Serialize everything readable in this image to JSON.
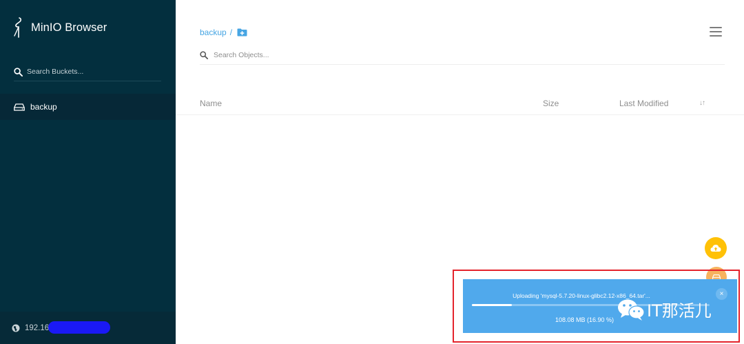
{
  "app": {
    "title": "MinIO Browser"
  },
  "sidebar": {
    "search_placeholder": "Search Buckets...",
    "buckets": [
      {
        "label": "backup"
      }
    ],
    "host": "192.16"
  },
  "main": {
    "breadcrumb": {
      "bucket": "backup",
      "separator": "/"
    },
    "search_placeholder": "Search Objects...",
    "columns": {
      "name": "Name",
      "size": "Size",
      "last_modified": "Last Modified"
    }
  },
  "upload": {
    "title": "Uploading 'mysql-5.7.20-linux-glibc2.12-x86_64.tar'...",
    "status": "108.08 MB (16.90 %)",
    "progress_percent": 16.9,
    "close_label": "×"
  },
  "watermark": {
    "text": "IT那活儿"
  },
  "colors": {
    "sidebar_bg": "#032f3e",
    "accent_link": "#46a5e3",
    "fab_upload": "#ffc107",
    "upload_panel": "#50a9ec",
    "highlight_border": "#e4222b"
  },
  "icons": {
    "logo": "minio-bird-logo",
    "bucket_search": "search-icon",
    "bucket": "hdd-icon",
    "host": "globe-icon",
    "add_folder": "folder-plus-icon",
    "object_search": "search-icon",
    "menu": "hamburger-icon",
    "sort": "sort-icon",
    "upload_fab": "cloud-upload-icon",
    "create_bucket_fab": "hdd-icon",
    "watermark": "wechat-icon"
  }
}
